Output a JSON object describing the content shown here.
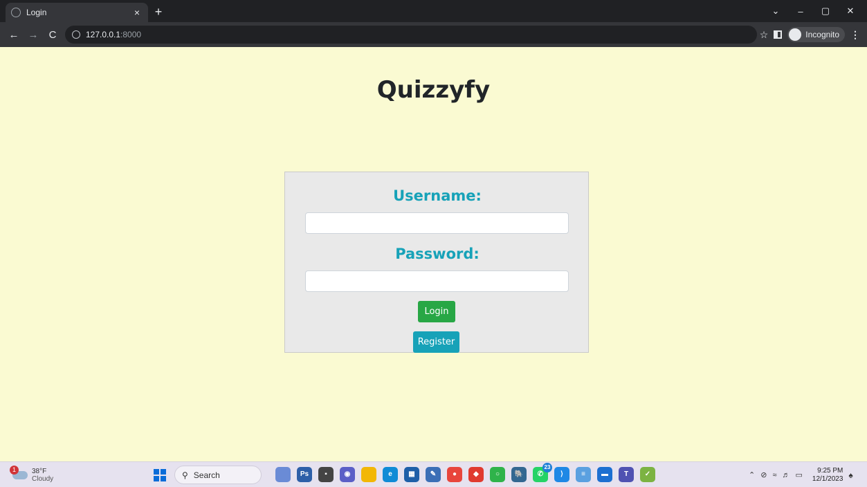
{
  "browser": {
    "tab_title": "Login",
    "tab_close": "×",
    "new_tab": "+",
    "nav": {
      "back": "←",
      "forward": "→",
      "reload": "C"
    },
    "url_host": "127.0.0.1",
    "url_port": ":8000",
    "incognito_label": "Incognito",
    "menu_glyph": "⋮",
    "star_glyph": "☆",
    "window": {
      "tabsearch": "⌄",
      "minimize": "–",
      "maximize": "▢",
      "close": "✕"
    }
  },
  "page": {
    "title": "Quizzyfy",
    "username_label": "Username:",
    "password_label": "Password:",
    "username_value": "",
    "password_value": "",
    "login_button": "Login",
    "register_button": "Register"
  },
  "taskbar": {
    "weather_temp": "38°F",
    "weather_condition": "Cloudy",
    "weather_badge": "1",
    "search_placeholder": "Search",
    "whatsapp_badge": "23",
    "time": "9:25 PM",
    "date": "12/1/2023",
    "apps": [
      {
        "name": "landscape-icon",
        "color": "#6a8bd6",
        "glyph": ""
      },
      {
        "name": "photoshop-express-icon",
        "color": "#2d5fa8",
        "glyph": "Ps"
      },
      {
        "name": "task-view-icon",
        "color": "#444444",
        "glyph": "▪"
      },
      {
        "name": "teams-chat-icon",
        "color": "#5b5fc7",
        "glyph": "◉"
      },
      {
        "name": "file-explorer-icon",
        "color": "#f2b705",
        "glyph": ""
      },
      {
        "name": "edge-icon",
        "color": "#0f8bd6",
        "glyph": "e"
      },
      {
        "name": "store-icon",
        "color": "#1e5fa8",
        "glyph": "▦"
      },
      {
        "name": "pen-app-icon",
        "color": "#3b6fb6",
        "glyph": "✎"
      },
      {
        "name": "chrome-icon",
        "color": "#e8453c",
        "glyph": "●"
      },
      {
        "name": "red-app-icon",
        "color": "#e03a2f",
        "glyph": "◆"
      },
      {
        "name": "circle-app-icon",
        "color": "#2fb34a",
        "glyph": "○"
      },
      {
        "name": "postgres-icon",
        "color": "#336791",
        "glyph": "🐘"
      },
      {
        "name": "whatsapp-icon",
        "color": "#25d366",
        "glyph": "✆"
      },
      {
        "name": "vscode-icon",
        "color": "#1e88e5",
        "glyph": "⟩"
      },
      {
        "name": "notepad-icon",
        "color": "#5aa0e0",
        "glyph": "≡"
      },
      {
        "name": "monitor-app-icon",
        "color": "#1c6fd1",
        "glyph": "▬"
      },
      {
        "name": "teams-icon",
        "color": "#4f52b2",
        "glyph": "T"
      },
      {
        "name": "cleaner-icon",
        "color": "#7cb342",
        "glyph": "✓"
      }
    ]
  }
}
